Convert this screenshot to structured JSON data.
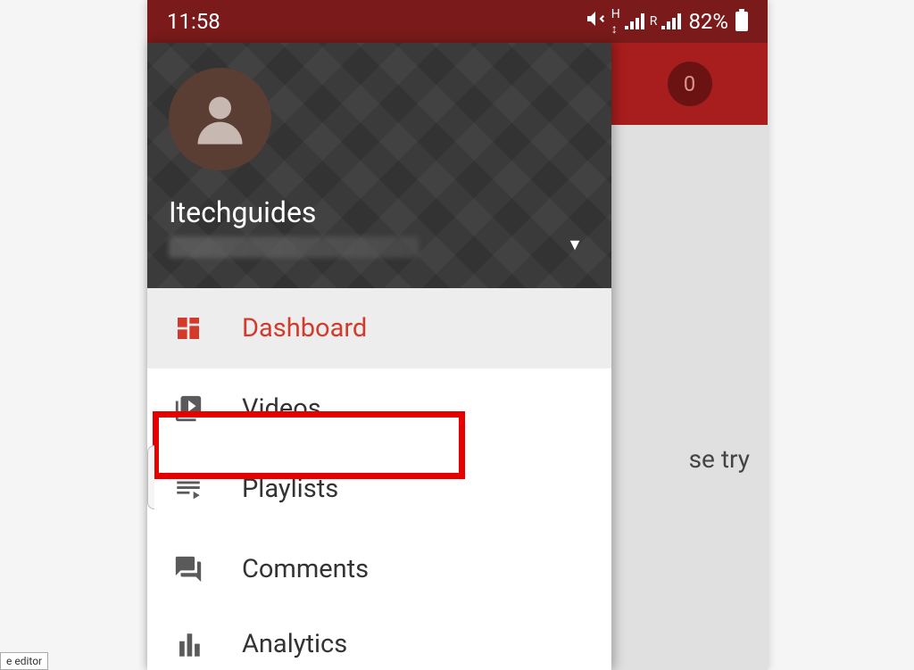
{
  "status": {
    "time": "11:58",
    "battery_pct": "82%",
    "net_indicator_h": "H",
    "net_indicator_r": "R"
  },
  "background": {
    "badge_count": "0",
    "partial_text": "se try"
  },
  "drawer": {
    "username": "Itechguides",
    "items": [
      {
        "label": "Dashboard"
      },
      {
        "label": "Videos"
      },
      {
        "label": "Playlists"
      },
      {
        "label": "Comments"
      },
      {
        "label": "Analytics"
      }
    ]
  },
  "footer_tag": "e editor"
}
